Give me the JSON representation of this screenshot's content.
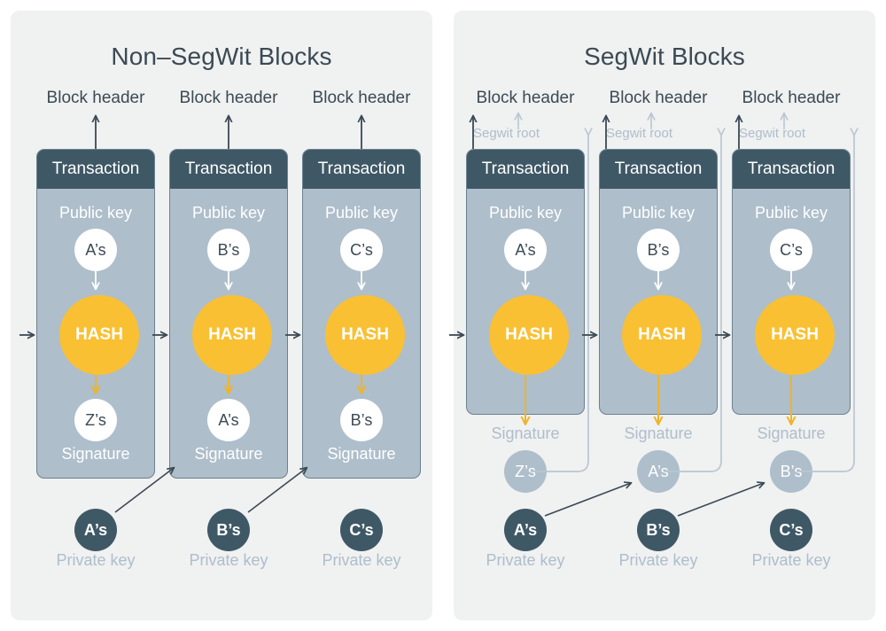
{
  "figure": {
    "title_left": "Non–SegWit Blocks",
    "title_right": "SegWit Blocks"
  },
  "labels": {
    "block_header": "Block header",
    "transaction": "Transaction",
    "public_key": "Public key",
    "signature": "Signature",
    "private_key": "Private key",
    "segwit_root": "Segwit root",
    "hash": "HASH"
  },
  "colors": {
    "panel_bg": "#f0f1f1",
    "page_bg": "#ffffff",
    "tx_header": "#3f5866",
    "tx_body": "#aebecb",
    "tx_border": "#6d818f",
    "hash_circle": "#f9c033",
    "dark_circle": "#3f5866",
    "muted_text": "#aebecb",
    "dark_text": "#3b4a54",
    "arrow_dark": "#3b4a54",
    "arrow_gold": "#f0b429",
    "connector_muted": "#b9c7d1"
  },
  "panels": [
    {
      "id": "non-segwit",
      "title": "Non–SegWit Blocks",
      "signature_inside_transaction": true,
      "has_segwit_root": false,
      "blocks": [
        {
          "index": 1,
          "block_header": "Block header",
          "transaction": "Transaction",
          "public_key_label": "Public key",
          "public_key": "A’s",
          "hash": "HASH",
          "signature_label": "Signature",
          "signature": "Z’s",
          "private_key_label": "Private key",
          "private_key": "A’s"
        },
        {
          "index": 2,
          "block_header": "Block header",
          "transaction": "Transaction",
          "public_key_label": "Public key",
          "public_key": "B’s",
          "hash": "HASH",
          "signature_label": "Signature",
          "signature": "A’s",
          "private_key_label": "Private key",
          "private_key": "B’s"
        },
        {
          "index": 3,
          "block_header": "Block header",
          "transaction": "Transaction",
          "public_key_label": "Public key",
          "public_key": "C’s",
          "hash": "HASH",
          "signature_label": "Signature",
          "signature": "B’s",
          "private_key_label": "Private key",
          "private_key": "C’s"
        }
      ]
    },
    {
      "id": "segwit",
      "title": "SegWit Blocks",
      "signature_inside_transaction": false,
      "has_segwit_root": true,
      "blocks": [
        {
          "index": 1,
          "block_header": "Block header",
          "segwit_root": "Segwit root",
          "transaction": "Transaction",
          "public_key_label": "Public key",
          "public_key": "A’s",
          "hash": "HASH",
          "signature_label": "Signature",
          "signature": "Z’s",
          "private_key_label": "Private key",
          "private_key": "A’s"
        },
        {
          "index": 2,
          "block_header": "Block header",
          "segwit_root": "Segwit root",
          "transaction": "Transaction",
          "public_key_label": "Public key",
          "public_key": "B’s",
          "hash": "HASH",
          "signature_label": "Signature",
          "signature": "A’s",
          "private_key_label": "Private key",
          "private_key": "B’s"
        },
        {
          "index": 3,
          "block_header": "Block header",
          "segwit_root": "Segwit root",
          "transaction": "Transaction",
          "public_key_label": "Public key",
          "public_key": "C’s",
          "hash": "HASH",
          "signature_label": "Signature",
          "signature": "B’s",
          "private_key_label": "Private key",
          "private_key": "C’s"
        }
      ]
    }
  ]
}
